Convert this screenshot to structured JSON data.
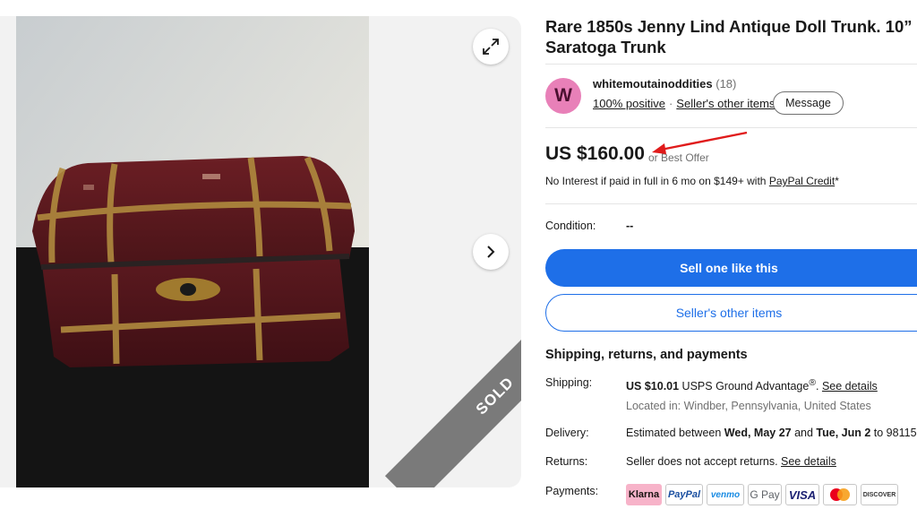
{
  "listing": {
    "title": "Rare 1850s Jenny Lind Antique Doll Trunk. 10” Saratoga Trunk",
    "sold_ribbon": "SOLD"
  },
  "seller": {
    "initial": "W",
    "name": "whitemoutainoddities",
    "count": "(18)",
    "positive": "100% positive",
    "separator": "·",
    "other_items": "Seller's other items",
    "message_button": "Message"
  },
  "price": {
    "amount": "US $160.00",
    "best_offer": "or Best Offer",
    "no_interest_text": "No Interest if paid in full in 6 mo on $149+ with ",
    "paypal_credit": "PayPal Credit",
    "asterisk": "*"
  },
  "condition": {
    "label": "Condition:",
    "value": "--"
  },
  "actions": {
    "sell_one": "Sell one like this",
    "sellers_other_items": "Seller's other items"
  },
  "shipping_section": {
    "title": "Shipping, returns, and payments",
    "shipping_label": "Shipping:",
    "shipping_price": "US $10.01",
    "shipping_service": " USPS Ground Advantage",
    "shipping_reg": "®",
    "shipping_dot": ". ",
    "see_details": "See details",
    "located": "Located in: Windber, Pennsylvania, United States",
    "delivery_label": "Delivery:",
    "delivery_prefix": "Estimated between ",
    "delivery_start": "Wed, May 27",
    "delivery_and": " and ",
    "delivery_end": "Tue, Jun 2",
    "delivery_to": " to 98115",
    "returns_label": "Returns:",
    "returns_text": "Seller does not accept returns. ",
    "returns_details": "See details",
    "payments_label": "Payments:"
  },
  "payment_methods": [
    "Klarna",
    "PayPal",
    "venmo",
    "G Pay",
    "VISA",
    "",
    "DISCOVER"
  ],
  "colors": {
    "primary_blue": "#1e6fe8",
    "avatar_pink": "#e880b8",
    "arrow_red": "#e01b1b",
    "sold_gray": "#7a7a7a"
  },
  "icons": {
    "expand": "expand-icon",
    "next": "chevron-right-icon",
    "info": "info-icon"
  }
}
